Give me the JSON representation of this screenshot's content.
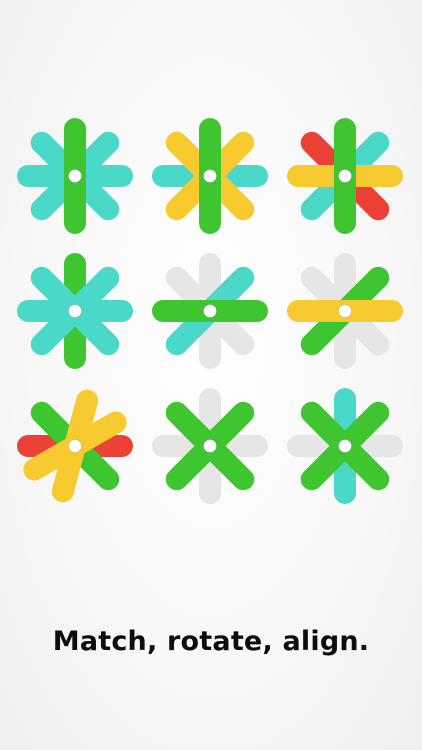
{
  "caption": "Match, rotate, align.",
  "colors": {
    "teal": "#4ad9c9",
    "green": "#3fc530",
    "yellow": "#f7ca2f",
    "red": "#ec4236",
    "gray": "#e6e6e6",
    "pin": "#ffffff"
  },
  "tiles": [
    {
      "name": "tile-1",
      "bars": [
        {
          "angle": 0,
          "color": "teal"
        },
        {
          "angle": 45,
          "color": "teal"
        },
        {
          "angle": 135,
          "color": "teal"
        },
        {
          "angle": 90,
          "color": "green"
        }
      ]
    },
    {
      "name": "tile-2",
      "bars": [
        {
          "angle": 0,
          "color": "teal"
        },
        {
          "angle": 135,
          "color": "yellow"
        },
        {
          "angle": 45,
          "color": "yellow"
        },
        {
          "angle": 90,
          "color": "green"
        }
      ]
    },
    {
      "name": "tile-3",
      "bars": [
        {
          "angle": 135,
          "color": "teal"
        },
        {
          "angle": 45,
          "color": "red"
        },
        {
          "angle": 0,
          "color": "yellow"
        },
        {
          "angle": 90,
          "color": "green"
        }
      ]
    },
    {
      "name": "tile-4",
      "bars": [
        {
          "angle": 0,
          "color": "teal"
        },
        {
          "angle": 90,
          "color": "green"
        },
        {
          "angle": 45,
          "color": "teal"
        },
        {
          "angle": 135,
          "color": "teal"
        }
      ]
    },
    {
      "name": "tile-5",
      "bars": [
        {
          "angle": 90,
          "color": "gray"
        },
        {
          "angle": 45,
          "color": "gray"
        },
        {
          "angle": 135,
          "color": "teal"
        },
        {
          "angle": 0,
          "color": "green"
        }
      ]
    },
    {
      "name": "tile-6",
      "bars": [
        {
          "angle": 90,
          "color": "gray"
        },
        {
          "angle": 45,
          "color": "gray"
        },
        {
          "angle": 135,
          "color": "green"
        },
        {
          "angle": 0,
          "color": "yellow"
        }
      ]
    },
    {
      "name": "tile-7",
      "bars": [
        {
          "angle": 0,
          "color": "red"
        },
        {
          "angle": 45,
          "color": "green"
        },
        {
          "angle": 105,
          "color": "yellow"
        },
        {
          "angle": 150,
          "color": "yellow"
        }
      ]
    },
    {
      "name": "tile-8",
      "bars": [
        {
          "angle": 0,
          "color": "gray"
        },
        {
          "angle": 90,
          "color": "gray"
        },
        {
          "angle": 45,
          "color": "green"
        },
        {
          "angle": 135,
          "color": "green"
        }
      ]
    },
    {
      "name": "tile-9",
      "bars": [
        {
          "angle": 0,
          "color": "gray"
        },
        {
          "angle": 90,
          "color": "teal"
        },
        {
          "angle": 45,
          "color": "green"
        },
        {
          "angle": 135,
          "color": "green"
        }
      ]
    }
  ]
}
